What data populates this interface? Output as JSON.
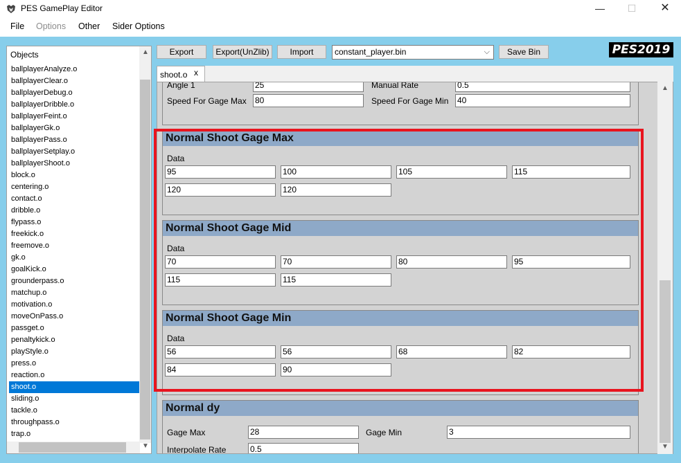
{
  "window": {
    "title": "PES GamePlay Editor",
    "minimize": "—",
    "maximize": "☐",
    "close": "✕"
  },
  "menu": {
    "file": "File",
    "options": "Options",
    "other": "Other",
    "sider": "Sider Options"
  },
  "objects": {
    "header": "Objects",
    "items": [
      "ballplayerAnalyze.o",
      "ballplayerClear.o",
      "ballplayerDebug.o",
      "ballplayerDribble.o",
      "ballplayerFeint.o",
      "ballplayerGk.o",
      "ballplayerPass.o",
      "ballplayerSetplay.o",
      "ballplayerShoot.o",
      "block.o",
      "centering.o",
      "contact.o",
      "dribble.o",
      "flypass.o",
      "freekick.o",
      "freemove.o",
      "gk.o",
      "goalKick.o",
      "grounderpass.o",
      "matchup.o",
      "motivation.o",
      "moveOnPass.o",
      "passget.o",
      "penaltykick.o",
      "playStyle.o",
      "press.o",
      "reaction.o",
      "shoot.o",
      "sliding.o",
      "tackle.o",
      "throughpass.o",
      "trap.o"
    ],
    "selected": "shoot.o"
  },
  "toolbar": {
    "export": "Export",
    "export_unzlib": "Export(UnZlib)",
    "import": "Import",
    "file_select": "constant_player.bin",
    "save": "Save Bin",
    "logo": "PES2019"
  },
  "tab": {
    "label": "shoot.o",
    "close": "x"
  },
  "top_group": {
    "angle_label": "Angle 1",
    "angle_value": "25",
    "manual_label": "Manual Rate",
    "manual_value": "0.5",
    "speed_max_label": "Speed For Gage Max",
    "speed_max_value": "80",
    "speed_min_label": "Speed For Gage Min",
    "speed_min_value": "40"
  },
  "gage_max": {
    "title": "Normal Shoot Gage Max",
    "data_label": "Data",
    "values": [
      "95",
      "100",
      "105",
      "115",
      "120",
      "120"
    ]
  },
  "gage_mid": {
    "title": "Normal Shoot Gage Mid",
    "data_label": "Data",
    "values": [
      "70",
      "70",
      "80",
      "95",
      "115",
      "115"
    ]
  },
  "gage_min": {
    "title": "Normal Shoot Gage Min",
    "data_label": "Data",
    "values": [
      "56",
      "56",
      "68",
      "82",
      "84",
      "90"
    ]
  },
  "normal_dy": {
    "title": "Normal dy",
    "gage_max_label": "Gage Max",
    "gage_max_value": "28",
    "gage_min_label": "Gage Min",
    "gage_min_value": "3",
    "interp_label": "Interpolate Rate",
    "interp_value": "0.5"
  },
  "colors": {
    "accent": "#0078d7",
    "background": "#87ceeb",
    "highlight": "#e8141e",
    "group_title": "#8ea9c8"
  }
}
